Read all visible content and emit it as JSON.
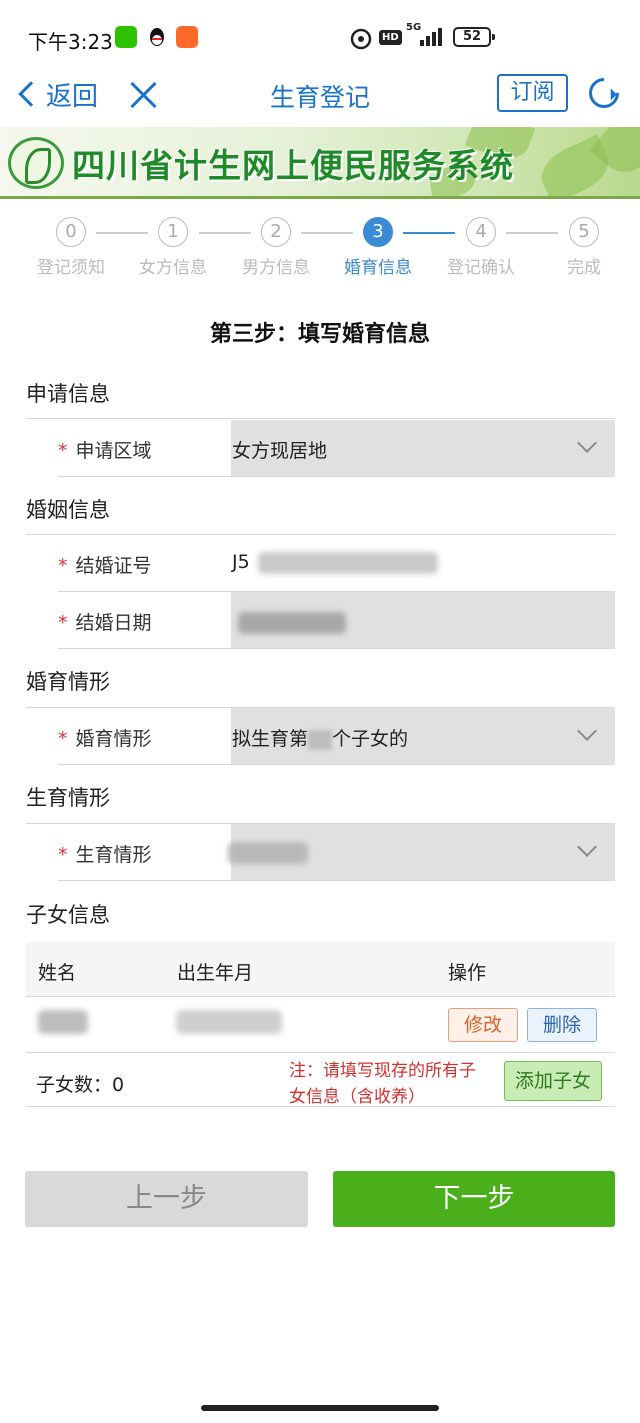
{
  "status_bar": {
    "time": "下午3:23",
    "network": "5G",
    "hd": "HD",
    "battery": "52",
    "icons": [
      "wechat-icon",
      "qq-icon",
      "taobao-icon",
      "alarm-icon",
      "hd-icon",
      "signal-icon",
      "battery-icon"
    ]
  },
  "nav": {
    "back_label": "返回",
    "title": "生育登记",
    "subscribe_label": "订阅"
  },
  "banner": {
    "text": "四川省计生网上便民服务系统"
  },
  "steps": {
    "active_index": 3,
    "items": [
      {
        "num": "0",
        "label": "登记须知"
      },
      {
        "num": "1",
        "label": "女方信息"
      },
      {
        "num": "2",
        "label": "男方信息"
      },
      {
        "num": "3",
        "label": "婚育信息"
      },
      {
        "num": "4",
        "label": "登记确认"
      },
      {
        "num": "5",
        "label": "完成"
      }
    ]
  },
  "heading": "第三步：填写婚育信息",
  "required_mark": "*",
  "sections": {
    "apply": {
      "title": "申请信息",
      "area_label": "申请区域",
      "area_value": "女方现居地"
    },
    "marriage": {
      "title": "婚姻信息",
      "cert_label": "结婚证号",
      "cert_value": "J5",
      "date_label": "结婚日期"
    },
    "situation": {
      "title": "婚育情形",
      "label": "婚育情形",
      "value_pre": "拟生育第",
      "value_post": "个子女的"
    },
    "birth": {
      "title": "生育情形",
      "label": "生育情形"
    },
    "children": {
      "title": "子女信息",
      "col_name": "姓名",
      "col_birth": "出生年月",
      "col_action": "操作",
      "edit_label": "修改",
      "delete_label": "删除",
      "count_label": "子女数：0",
      "note": "注：请填写现存的所有子女信息（含收养）",
      "add_label": "添加子女"
    }
  },
  "footer": {
    "prev_label": "上一步",
    "next_label": "下一步"
  },
  "colors": {
    "primary_blue": "#1a73c8",
    "step_active": "#3a8ad4",
    "next_green": "#4aaf1a",
    "required_red": "#d33333",
    "note_red": "#d32f2f"
  }
}
